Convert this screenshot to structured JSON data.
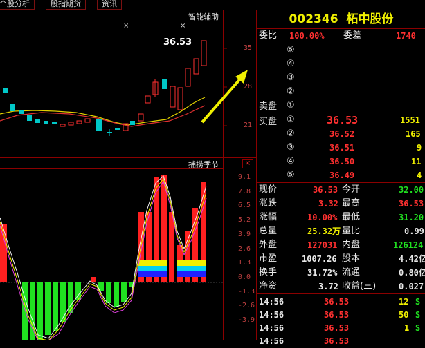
{
  "tabs": [
    "个股分析",
    "股指期货",
    "资讯"
  ],
  "upper_panel": {
    "label": "智能辅助",
    "price_tag": "36.53",
    "y_ticks": [
      "35",
      "28",
      "21"
    ],
    "x_markers": [
      "×",
      "×"
    ]
  },
  "lower_panel": {
    "label": "捕捞季节",
    "y_ticks": [
      "9.1",
      "7.8",
      "6.5",
      "5.2",
      "3.9",
      "2.6",
      "1.3",
      "0.0",
      "-1.3",
      "-2.6",
      "-3.9"
    ]
  },
  "stock": {
    "code": "002346",
    "name": "柘中股份"
  },
  "ratio_row": {
    "label1": "委比",
    "value1": "100.00%",
    "label2": "委差",
    "value2": "1740"
  },
  "sell_levels": [
    "⑤",
    "④",
    "③",
    "②",
    "①"
  ],
  "sell_label": "卖盘",
  "buy_label": "买盘",
  "buy_levels": [
    {
      "idx": "①",
      "price": "36.53",
      "vol": "1551"
    },
    {
      "idx": "②",
      "price": "36.52",
      "vol": "165"
    },
    {
      "idx": "③",
      "price": "36.51",
      "vol": "9"
    },
    {
      "idx": "④",
      "price": "36.50",
      "vol": "11"
    },
    {
      "idx": "⑤",
      "price": "36.49",
      "vol": "4"
    }
  ],
  "quote_rows": [
    {
      "l1": "现价",
      "v1": "36.53",
      "c1": "red",
      "l2": "今开",
      "v2": "32.00",
      "c2": "green"
    },
    {
      "l1": "涨跌",
      "v1": "3.32",
      "c1": "red",
      "l2": "最高",
      "v2": "36.53",
      "c2": "red"
    },
    {
      "l1": "涨幅",
      "v1": "10.00%",
      "c1": "red",
      "l2": "最低",
      "v2": "31.20",
      "c2": "green"
    },
    {
      "l1": "总量",
      "v1": "25.32万",
      "c1": "yellow",
      "l2": "量比",
      "v2": "0.99",
      "c2": "white"
    },
    {
      "l1": "外盘",
      "v1": "127031",
      "c1": "red",
      "l2": "内盘",
      "v2": "126124",
      "c2": "green"
    },
    {
      "l1": "市盈",
      "v1": "1007.26",
      "c1": "white",
      "l2": "股本",
      "v2": "4.42亿",
      "c2": "white"
    },
    {
      "l1": "换手",
      "v1": "31.72%",
      "c1": "white",
      "l2": "流通",
      "v2": "0.80亿",
      "c2": "white"
    },
    {
      "l1": "净资",
      "v1": "3.72",
      "c1": "white",
      "l2": "收益(三)",
      "v2": "0.027",
      "c2": "white"
    }
  ],
  "ticks": [
    {
      "time": "14:56",
      "price": "36.53",
      "vol": "12",
      "side": "S"
    },
    {
      "time": "14:56",
      "price": "36.53",
      "vol": "50",
      "side": "S"
    },
    {
      "time": "14:56",
      "price": "36.53",
      "vol": "1",
      "side": "S"
    },
    {
      "time": "14:56",
      "price": "36.53",
      "vol": "",
      "side": ""
    }
  ],
  "colors": {
    "up": "#ff3030",
    "down": "#20e020",
    "grid": "#8b0000",
    "code": "#f0f000"
  }
}
